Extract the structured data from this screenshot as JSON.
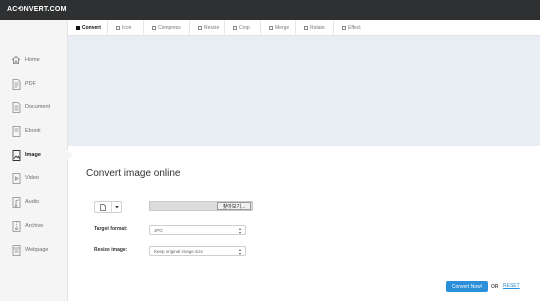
{
  "app": {
    "logo": "AC⟲NVERT.COM"
  },
  "sidebar": {
    "items": [
      {
        "label": "Home",
        "icon": "home-icon",
        "active": false
      },
      {
        "label": "PDF",
        "icon": "pdf-icon",
        "active": false
      },
      {
        "label": "Document",
        "icon": "document-icon",
        "active": false
      },
      {
        "label": "Ebook",
        "icon": "ebook-icon",
        "active": false
      },
      {
        "label": "Image",
        "icon": "image-icon",
        "active": true
      },
      {
        "label": "Video",
        "icon": "video-icon",
        "active": false
      },
      {
        "label": "Audio",
        "icon": "audio-icon",
        "active": false
      },
      {
        "label": "Archive",
        "icon": "archive-icon",
        "active": false
      },
      {
        "label": "Webpage",
        "icon": "webpage-icon",
        "active": false
      }
    ]
  },
  "tabs": [
    {
      "label": "Convert",
      "active": true
    },
    {
      "label": "Icon",
      "active": false
    },
    {
      "label": "Compress",
      "active": false
    },
    {
      "label": "Resize",
      "active": false
    },
    {
      "label": "Crop",
      "active": false
    },
    {
      "label": "Merge",
      "active": false
    },
    {
      "label": "Rotate",
      "active": false
    },
    {
      "label": "Effect",
      "active": false
    }
  ],
  "main": {
    "title": "Convert image online",
    "file_button_label": "찾아보기...",
    "target_format_label": "Target format:",
    "target_format_value": "JPG",
    "resize_label": "Resize image:",
    "resize_value": "Keep original image size",
    "convert_button": "Convert Now!",
    "or_text": "OR",
    "reset_link": "RESET"
  },
  "colors": {
    "topbar": "#2f3032",
    "banner": "#e8eef4",
    "accent": "#2b8fd9",
    "sidebar_bg": "#f5f5f5"
  }
}
